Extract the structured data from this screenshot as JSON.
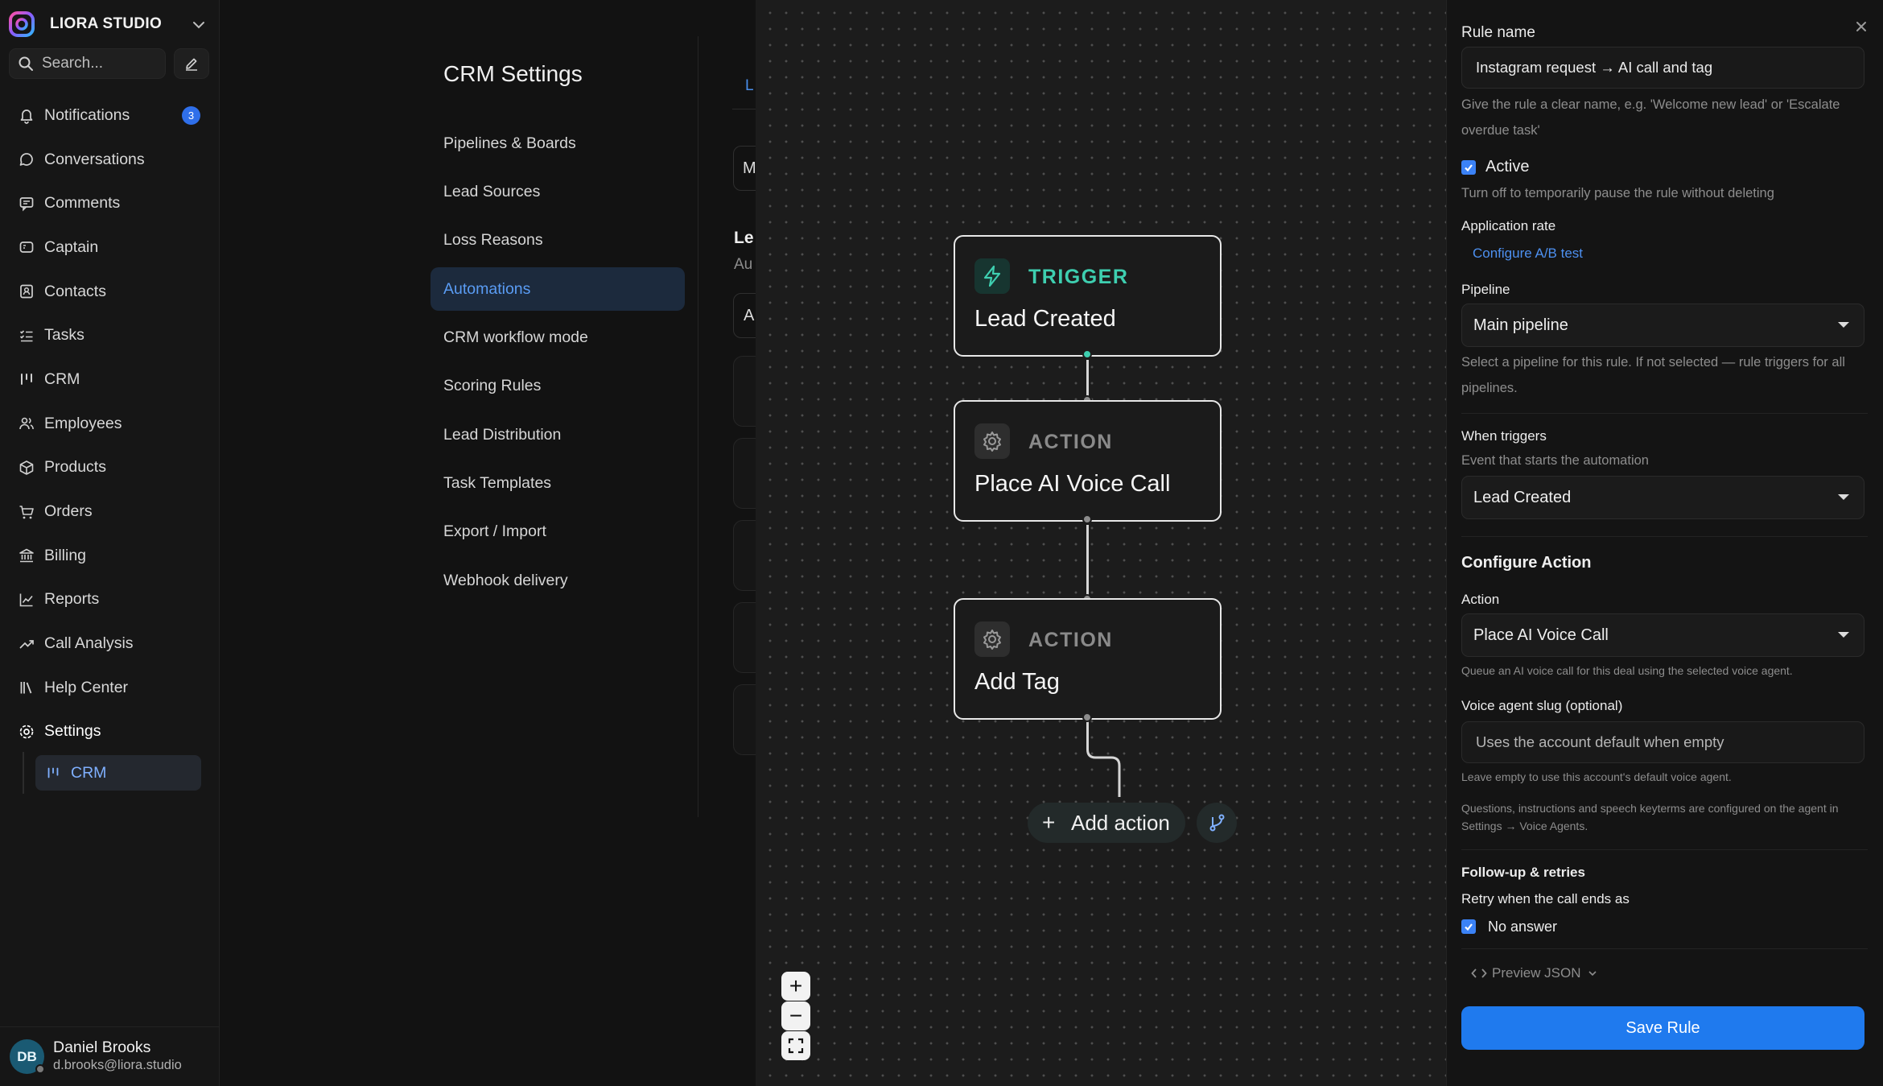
{
  "brand": {
    "name": "LIORA STUDIO"
  },
  "search": {
    "placeholder": "Search..."
  },
  "nav": {
    "items": [
      {
        "label": "Notifications",
        "icon": "bell-icon",
        "badge": "3"
      },
      {
        "label": "Conversations",
        "icon": "chat-icon"
      },
      {
        "label": "Comments",
        "icon": "comment-icon"
      },
      {
        "label": "Captain",
        "icon": "captain-icon"
      },
      {
        "label": "Contacts",
        "icon": "contacts-icon"
      },
      {
        "label": "Tasks",
        "icon": "tasks-icon"
      },
      {
        "label": "CRM",
        "icon": "kanban-icon"
      },
      {
        "label": "Employees",
        "icon": "users-icon"
      },
      {
        "label": "Products",
        "icon": "box-icon"
      },
      {
        "label": "Orders",
        "icon": "cart-icon"
      },
      {
        "label": "Billing",
        "icon": "bank-icon"
      },
      {
        "label": "Reports",
        "icon": "chart-icon"
      },
      {
        "label": "Call Analysis",
        "icon": "trend-icon"
      },
      {
        "label": "Help Center",
        "icon": "library-icon"
      },
      {
        "label": "Settings",
        "icon": "gear-icon"
      }
    ],
    "sub_item": "CRM"
  },
  "user": {
    "initials": "DB",
    "name": "Daniel Brooks",
    "email": "d.brooks@liora.studio"
  },
  "settings": {
    "title": "CRM Settings",
    "menu": [
      "Pipelines & Boards",
      "Lead Sources",
      "Loss Reasons",
      "Automations",
      "CRM workflow mode",
      "Scoring Rules",
      "Lead Distribution",
      "Task Templates",
      "Export / Import",
      "Webhook delivery"
    ],
    "active_index": 3,
    "peek": {
      "tab": "L",
      "input1": "M",
      "heading": "Le",
      "sub": "Au",
      "input2": "A"
    }
  },
  "canvas": {
    "nodes": [
      {
        "kind": "TRIGGER",
        "title": "Lead Created"
      },
      {
        "kind": "ACTION",
        "title": "Place AI Voice Call"
      },
      {
        "kind": "ACTION",
        "title": "Add Tag"
      }
    ],
    "add_action": "Add action",
    "zoom_in": "+",
    "zoom_out": "−"
  },
  "panel": {
    "rule_name_label": "Rule name",
    "rule_name_value": "Instagram request → AI call and tag",
    "rule_name_help": "Give the rule a clear name, e.g. 'Welcome new lead' or 'Escalate overdue task'",
    "active_label": "Active",
    "active_checked": true,
    "active_help": "Turn off to temporarily pause the rule without deleting",
    "application_rate_label": "Application rate",
    "ab_link": "Configure A/B test",
    "pipeline_label": "Pipeline",
    "pipeline_value": "Main pipeline",
    "pipeline_help": "Select a pipeline for this rule. If not selected — rule triggers for all pipelines.",
    "when_label": "When triggers",
    "when_help": "Event that starts the automation",
    "when_value": "Lead Created",
    "configure_title": "Configure Action",
    "action_label": "Action",
    "action_value": "Place AI Voice Call",
    "action_help": "Queue an AI voice call for this deal using the selected voice agent.",
    "slug_label": "Voice agent slug (optional)",
    "slug_placeholder": "Uses the account default when empty",
    "slug_help": "Leave empty to use this account's default voice agent.",
    "slug_note": "Questions, instructions and speech keyterms are configured on the agent in Settings → Voice Agents.",
    "followup_title": "Follow-up & retries",
    "retry_label": "Retry when the call ends as",
    "no_answer_label": "No answer",
    "no_answer_checked": true,
    "preview_json": "Preview JSON",
    "save_label": "Save Rule"
  },
  "colors": {
    "accent": "#1f7aee",
    "trigger": "#3ecfb0",
    "active_menu": "#5a9cf4"
  }
}
